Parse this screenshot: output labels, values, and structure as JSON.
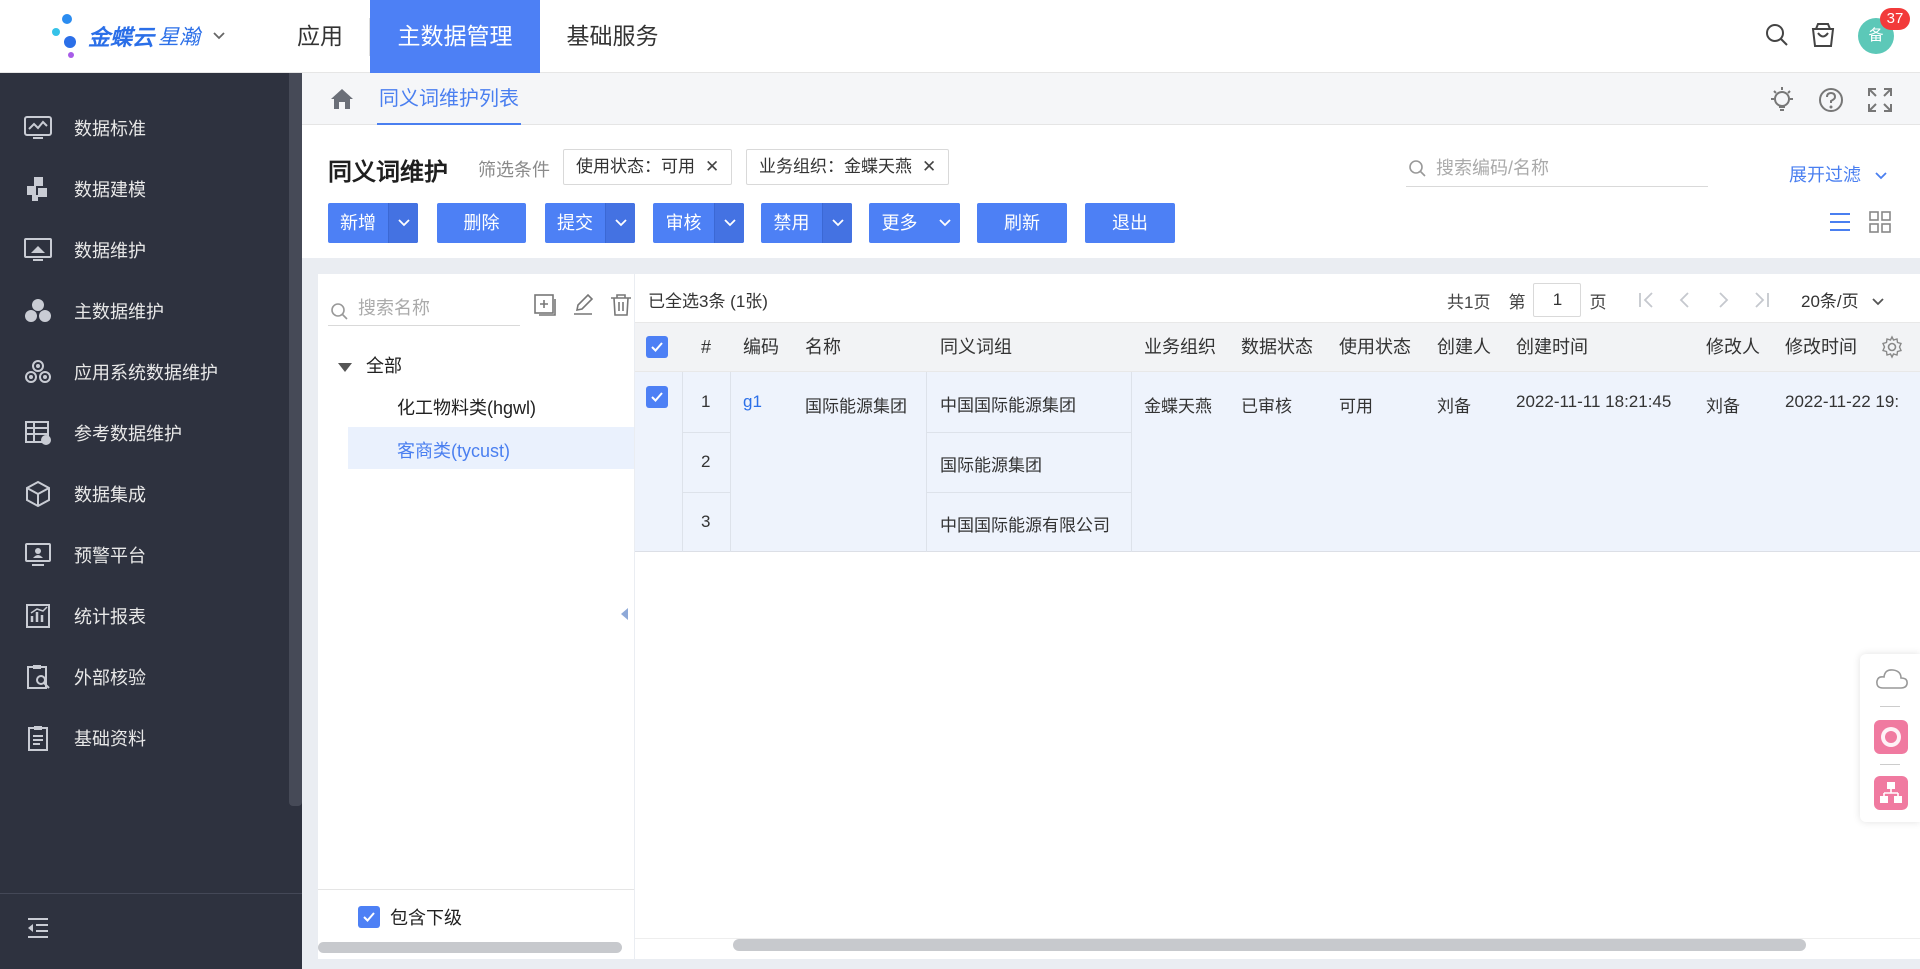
{
  "topbar": {
    "brand": "金蝶云",
    "brand_sub": "星瀚",
    "nav": [
      {
        "label": "应用"
      },
      {
        "label": "主数据管理"
      },
      {
        "label": "基础服务"
      }
    ],
    "avatar_text": "备",
    "badge_count": "37"
  },
  "sidebar": {
    "items": [
      {
        "label": "数据标准",
        "icon": "chart-monitor-icon"
      },
      {
        "label": "数据建模",
        "icon": "blocks-icon"
      },
      {
        "label": "数据维护",
        "icon": "monitor-icon"
      },
      {
        "label": "主数据维护",
        "icon": "three-circles-icon"
      },
      {
        "label": "应用系统数据维护",
        "icon": "cluster-icon"
      },
      {
        "label": "参考数据维护",
        "icon": "table-gear-icon"
      },
      {
        "label": "数据集成",
        "icon": "cube-icon"
      },
      {
        "label": "预警平台",
        "icon": "alert-screen-icon"
      },
      {
        "label": "统计报表",
        "icon": "report-icon"
      },
      {
        "label": "外部核验",
        "icon": "clipboard-search-icon"
      },
      {
        "label": "基础资料",
        "icon": "clipboard-icon"
      }
    ]
  },
  "breadcrumb": {
    "active_tab": "同义词维护列表"
  },
  "filter": {
    "title": "同义词维护",
    "label": "筛选条件",
    "chips": [
      {
        "text": "使用状态：可用"
      },
      {
        "text": "业务组织：金蝶天燕"
      }
    ],
    "search_placeholder": "搜索编码/名称",
    "expand_label": "展开过滤"
  },
  "toolbar": {
    "buttons": [
      {
        "label": "新增"
      },
      {
        "label": "删除"
      },
      {
        "label": "提交"
      },
      {
        "label": "审核"
      },
      {
        "label": "禁用"
      },
      {
        "label": "更多"
      },
      {
        "label": "刷新"
      },
      {
        "label": "退出"
      }
    ]
  },
  "tree": {
    "search_placeholder": "搜索名称",
    "nodes": [
      {
        "label": "全部"
      },
      {
        "label": "化工物料类(hgwl)"
      },
      {
        "label": "客商类(tycust)"
      }
    ],
    "include_sub_label": "包含下级"
  },
  "grid": {
    "selection_info": "已全选3条 (1张)",
    "pager": {
      "total": "共1页",
      "prefix": "第",
      "current": "1",
      "suffix": "页",
      "page_size": "20条/页"
    },
    "columns": [
      "#",
      "编码",
      "名称",
      "同义词组",
      "业务组织",
      "数据状态",
      "使用状态",
      "创建人",
      "创建时间",
      "修改人",
      "修改时间"
    ],
    "row": {
      "code": "g1",
      "name": "国际能源集团",
      "org": "金蝶天燕",
      "data_status": "已审核",
      "use_status": "可用",
      "creator": "刘备",
      "created_at": "2022-11-11 18:21:45",
      "modifier": "刘备",
      "modified_at": "2022-11-22 19:"
    },
    "sub_rows": [
      {
        "index": "1",
        "synonym": "中国国际能源集团"
      },
      {
        "index": "2",
        "synonym": "国际能源集团"
      },
      {
        "index": "3",
        "synonym": "中国国际能源有限公司"
      }
    ]
  },
  "colors": {
    "accent": "#4d80f5",
    "sidebar_bg": "#2e323f",
    "badge": "#f23a3a"
  }
}
